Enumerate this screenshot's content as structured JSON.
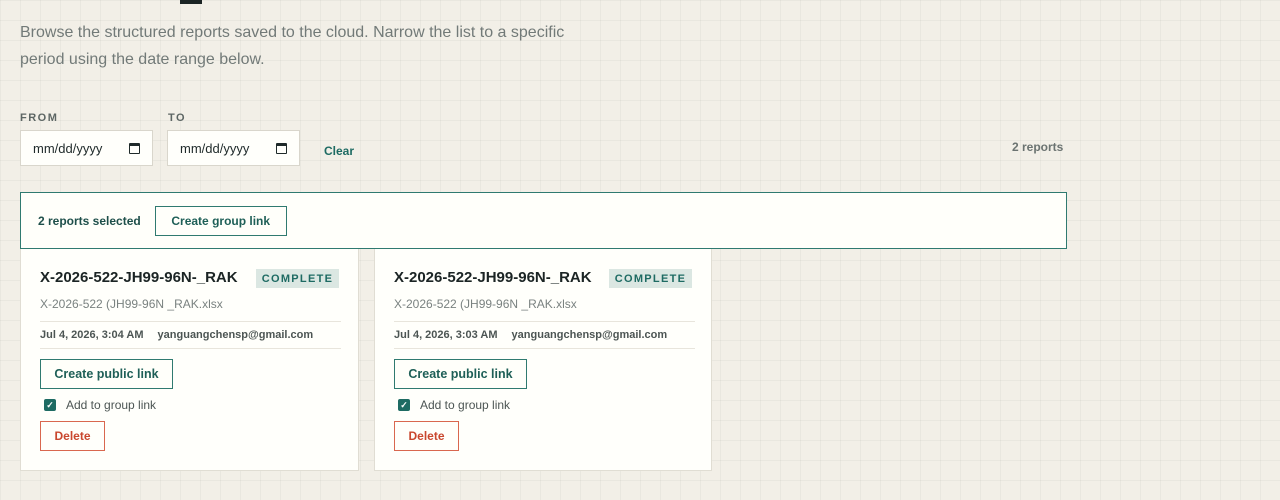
{
  "intro": {
    "line1": "Browse the structured reports saved to the cloud. Narrow the list to a specific",
    "line2": "period using the date range below."
  },
  "filters": {
    "from_label": "FROM",
    "to_label": "TO",
    "from_value": "mm/dd/yyyy",
    "to_value": "mm/dd/yyyy",
    "clear_label": "Clear",
    "calendar_icon": "calendar-icon"
  },
  "report_count": "2 reports",
  "selection": {
    "text": "2 reports selected",
    "group_link_label": "Create group link"
  },
  "reports": [
    {
      "title": "X-2026-522-JH99-96N-_RAK",
      "status": "COMPLETE",
      "file": "X-2026-522 (JH99-96N _RAK.xlsx",
      "date": "Jul 4, 2026, 3:04 AM",
      "email": "yanguangchensp@gmail.com",
      "public_link_label": "Create public link",
      "group_check_label": "Add to group link",
      "group_checked": true,
      "delete_label": "Delete"
    },
    {
      "title": "X-2026-522-JH99-96N-_RAK",
      "status": "COMPLETE",
      "file": "X-2026-522 (JH99-96N _RAK.xlsx",
      "date": "Jul 4, 2026, 3:03 AM",
      "email": "yanguangchensp@gmail.com",
      "public_link_label": "Create public link",
      "group_check_label": "Add to group link",
      "group_checked": true,
      "delete_label": "Delete"
    }
  ],
  "colors": {
    "accent": "#1e6b63",
    "danger": "#c9472e",
    "background": "#f2efe7"
  }
}
